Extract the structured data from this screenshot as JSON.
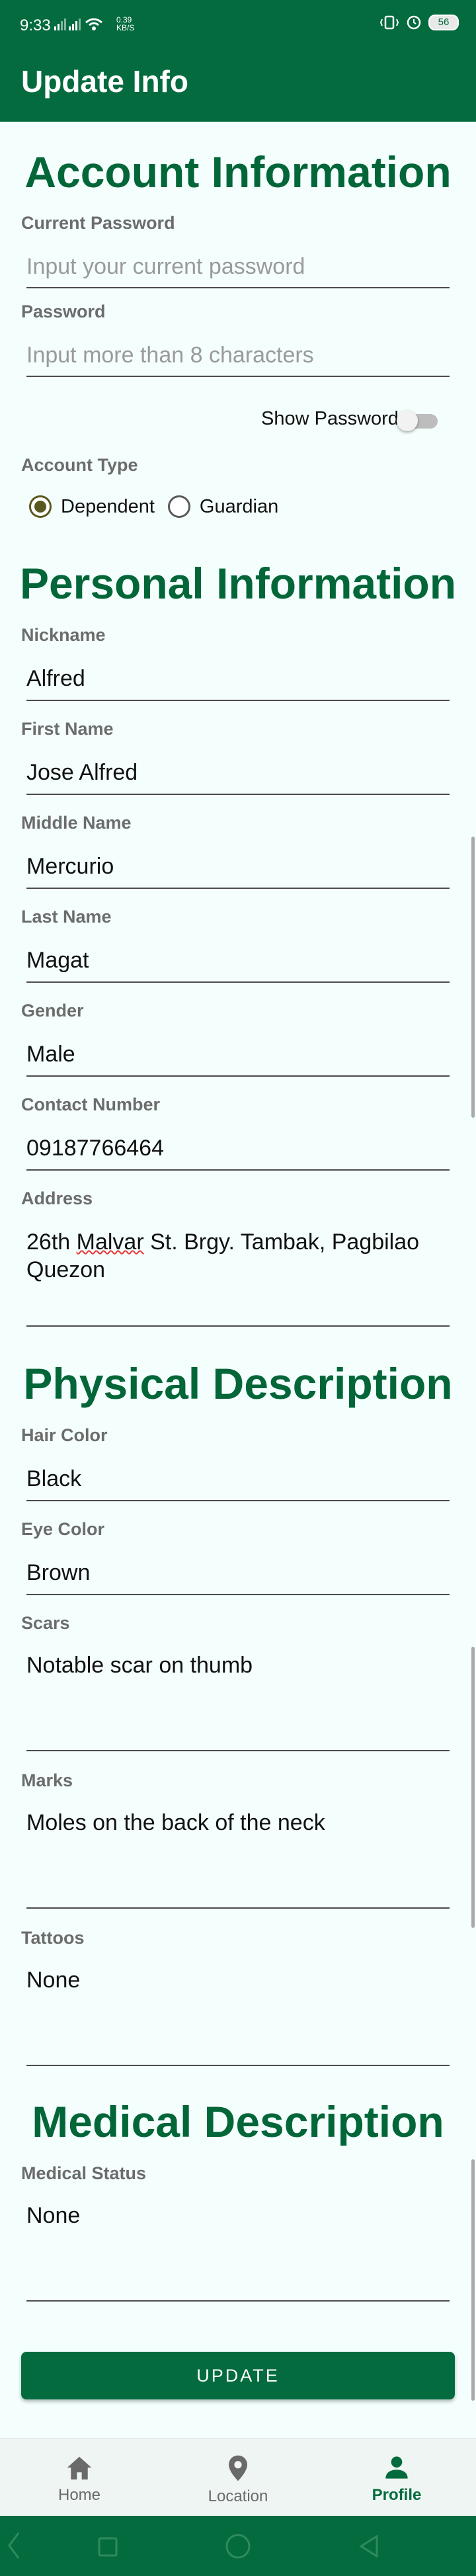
{
  "status": {
    "time": "9:33",
    "net_speed": "0.39 KB/S",
    "battery": "56"
  },
  "appbar": {
    "title": "Update Info"
  },
  "sections": {
    "account": "Account Information",
    "personal": "Personal Information",
    "physical": "Physical Description",
    "medical": "Medical Description"
  },
  "account": {
    "current_password_label": "Current Password",
    "current_password_placeholder": "Input your current password",
    "password_label": "Password",
    "password_placeholder": "Input more than 8 characters",
    "show_password_label": "Show Password",
    "account_type_label": "Account Type",
    "account_types": [
      "Dependent",
      "Guardian"
    ],
    "selected_account_type": "Dependent"
  },
  "personal": {
    "nickname_label": "Nickname",
    "nickname": "Alfred",
    "first_name_label": "First Name",
    "first_name": "Jose Alfred",
    "middle_name_label": "Middle Name",
    "middle_name": "Mercurio",
    "last_name_label": "Last Name",
    "last_name": "Magat",
    "gender_label": "Gender",
    "gender": "Male",
    "contact_label": "Contact Number",
    "contact": "09187766464",
    "address_label": "Address",
    "address_part1": "26th ",
    "address_misspelled": "Malvar",
    "address_part2": " St. Brgy. Tambak, Pagbilao Quezon"
  },
  "physical": {
    "hair_label": "Hair Color",
    "hair": "Black",
    "eye_label": "Eye Color",
    "eye": "Brown",
    "scars_label": "Scars",
    "scars": "Notable scar on thumb",
    "marks_label": "Marks",
    "marks": "Moles on the back of the neck",
    "tattoos_label": "Tattoos",
    "tattoos": "None"
  },
  "medical": {
    "status_label": "Medical Status",
    "status": "None"
  },
  "update_button": "UPDATE",
  "nav": {
    "home": "Home",
    "location": "Location",
    "profile": "Profile",
    "active": "Profile"
  },
  "colors": {
    "primary": "#046b3e",
    "heading": "#036639",
    "background": "#f4fffd"
  }
}
